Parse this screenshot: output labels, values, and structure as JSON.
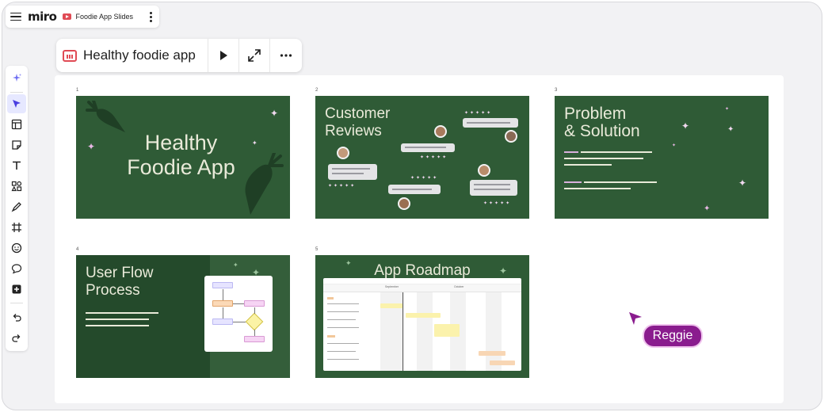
{
  "app": {
    "logo": "miro",
    "board_name": "Foodie App Slides"
  },
  "presentation": {
    "title": "Healthy foodie app"
  },
  "slides": [
    {
      "number": "1",
      "title_line1": "Healthy",
      "title_line2": "Foodie App"
    },
    {
      "number": "2",
      "title_line1": "Customer",
      "title_line2": "Reviews"
    },
    {
      "number": "3",
      "title_line1": "Problem",
      "title_line2": "& Solution"
    },
    {
      "number": "4",
      "title_line1": "User Flow",
      "title_line2": "Process"
    },
    {
      "number": "5",
      "title_line1": "App Roadmap",
      "roadmap_months": [
        "September",
        "October"
      ]
    }
  ],
  "collaborator": {
    "name": "Reggie",
    "color": "#8a1c8e"
  },
  "colors": {
    "slide_bg": "#2f5b36",
    "accent": "#e04b55",
    "active_tool": "#e6e8ff"
  },
  "toolbar": {
    "tools": [
      "magic-icon",
      "select-icon",
      "template-icon",
      "sticky-note-icon",
      "text-icon",
      "shapes-icon",
      "pen-icon",
      "frame-icon",
      "emoji-icon",
      "comment-icon",
      "add-icon",
      "undo-icon",
      "redo-icon"
    ]
  }
}
